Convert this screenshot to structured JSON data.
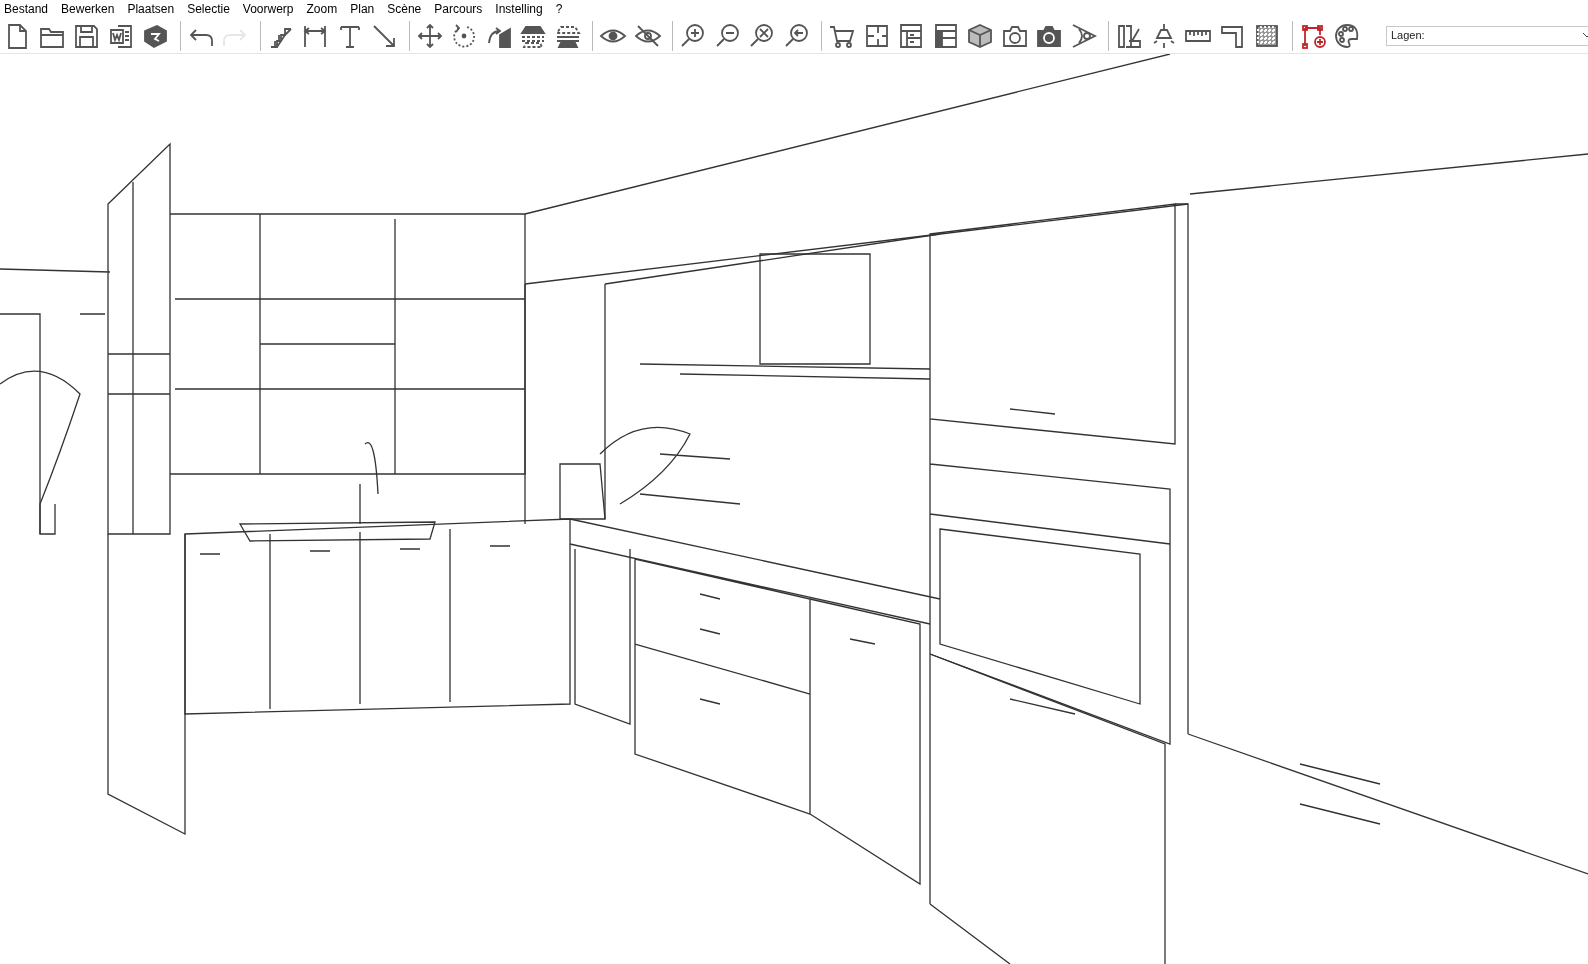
{
  "menu": [
    "Bestand",
    "Bewerken",
    "Plaatsen",
    "Selectie",
    "Voorwerp",
    "Zoom",
    "Plan",
    "Scène",
    "Parcours",
    "Instelling",
    "?"
  ],
  "toolbar": [
    [
      {
        "kind": "new",
        "disabled": false
      },
      {
        "kind": "open",
        "disabled": false
      },
      {
        "kind": "save",
        "disabled": false
      },
      {
        "kind": "word",
        "disabled": false
      },
      {
        "kind": "export3d",
        "disabled": false
      }
    ],
    [
      {
        "kind": "undo",
        "disabled": false
      },
      {
        "kind": "redo",
        "disabled": true
      }
    ],
    [
      {
        "kind": "stairs",
        "disabled": false
      },
      {
        "kind": "dimension",
        "disabled": false
      },
      {
        "kind": "text",
        "disabled": false
      },
      {
        "kind": "line",
        "disabled": false
      }
    ],
    [
      {
        "kind": "move",
        "disabled": false
      },
      {
        "kind": "rotate",
        "disabled": false
      },
      {
        "kind": "mirror",
        "disabled": false
      },
      {
        "kind": "raise",
        "disabled": false
      },
      {
        "kind": "lower",
        "disabled": false
      }
    ],
    [
      {
        "kind": "show",
        "disabled": false
      },
      {
        "kind": "hide",
        "disabled": false
      }
    ],
    [
      {
        "kind": "zoomin",
        "disabled": false
      },
      {
        "kind": "zoomout",
        "disabled": false
      },
      {
        "kind": "zoomfit",
        "disabled": false
      },
      {
        "kind": "zoomprev",
        "disabled": false
      }
    ],
    [
      {
        "kind": "cart",
        "disabled": false
      },
      {
        "kind": "plan",
        "disabled": false
      },
      {
        "kind": "cabinet",
        "disabled": false
      },
      {
        "kind": "cabinetfill",
        "disabled": false
      },
      {
        "kind": "cube",
        "disabled": false
      },
      {
        "kind": "camera",
        "disabled": false
      },
      {
        "kind": "camerafill",
        "disabled": false
      },
      {
        "kind": "view",
        "disabled": false
      }
    ],
    [
      {
        "kind": "material",
        "disabled": false
      },
      {
        "kind": "lamp",
        "disabled": false
      },
      {
        "kind": "ruler",
        "disabled": false
      },
      {
        "kind": "worktop",
        "disabled": false
      },
      {
        "kind": "checker",
        "disabled": false
      }
    ],
    [
      {
        "kind": "nodes",
        "disabled": false
      },
      {
        "kind": "palette",
        "disabled": false
      }
    ]
  ],
  "layers": {
    "placeholder": "Lagen:"
  }
}
